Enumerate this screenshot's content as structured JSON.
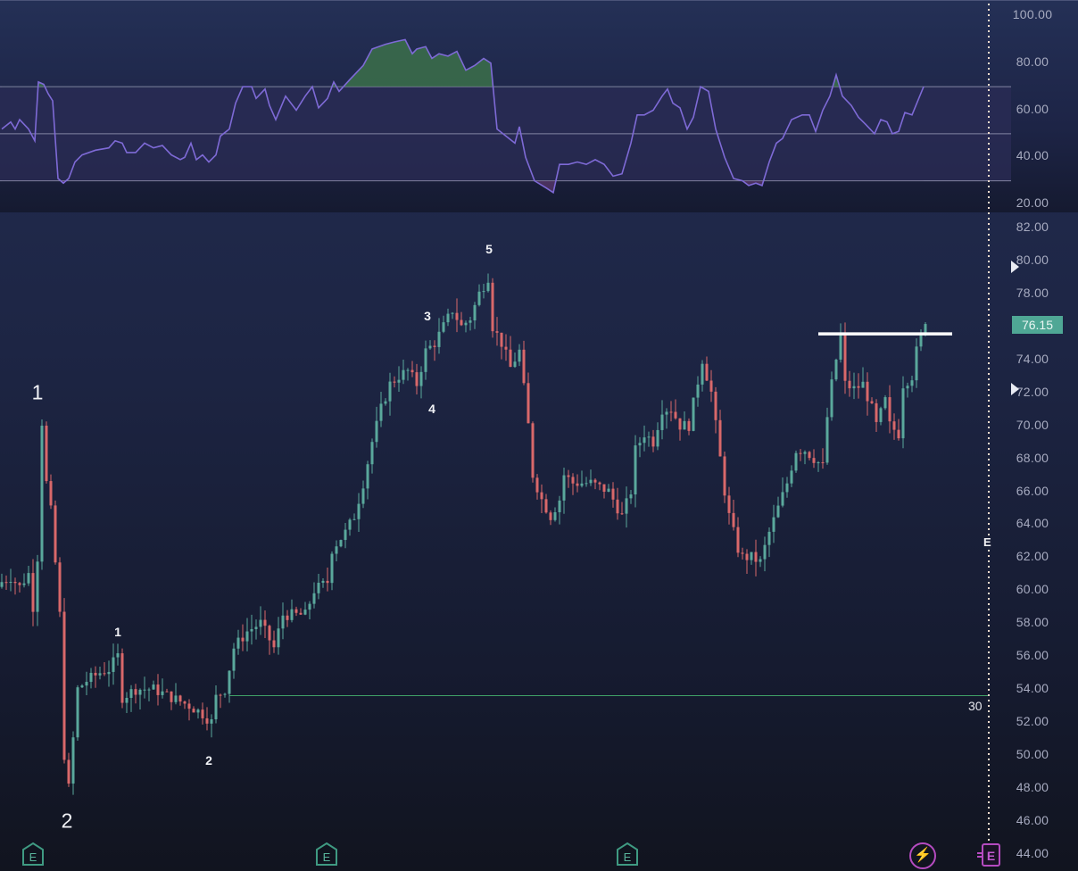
{
  "colors": {
    "up": "#5aa89c",
    "down": "#d9686a",
    "rsi_line": "#7e6ad6",
    "rsi_band": "#2b2c55",
    "level_line": "#9a9cb8",
    "support_line": "#3fa066",
    "resistance_line": "#ffffff",
    "crosshair": "#f1dccd",
    "last_price_bg": "#4fa795",
    "earnings_marker": "#3f9a82",
    "event_marker": "#b54bc0"
  },
  "rsi_axis": {
    "ticks": [
      "100.00",
      "80.00",
      "60.00",
      "40.00",
      "20.00"
    ]
  },
  "price_axis": {
    "ticks": [
      "82.00",
      "80.00",
      "78.00",
      "76.00",
      "74.00",
      "72.00",
      "70.00",
      "68.00",
      "66.00",
      "64.00",
      "62.00",
      "60.00",
      "58.00",
      "56.00",
      "54.00",
      "52.00",
      "50.00",
      "48.00",
      "46.00",
      "44.00"
    ]
  },
  "last_price": "76.15",
  "count_label": "30",
  "future_event_label": "E",
  "earnings_icon_label": "E",
  "event_icons": {
    "bolt": "⚡",
    "earnings": "E"
  },
  "wave_labels": {
    "major_1": "1",
    "major_2": "2",
    "minor_1": "1",
    "minor_2": "2",
    "minor_3": "3",
    "minor_4": "4",
    "minor_5": "5"
  },
  "chart_data": [
    {
      "type": "line",
      "title": "RSI",
      "ylim": [
        20,
        100
      ],
      "levels": [
        70,
        50,
        30
      ],
      "points": [
        [
          0,
          52
        ],
        [
          2,
          55
        ],
        [
          3,
          52
        ],
        [
          4,
          56
        ],
        [
          6,
          52
        ],
        [
          7.4,
          47
        ],
        [
          8.2,
          72
        ],
        [
          9.4,
          71
        ],
        [
          10.4,
          67
        ],
        [
          11.4,
          64
        ],
        [
          12.6,
          31
        ],
        [
          13.8,
          29
        ],
        [
          15,
          31
        ],
        [
          16.4,
          38
        ],
        [
          18,
          41
        ],
        [
          21,
          43
        ],
        [
          24,
          44
        ],
        [
          25.4,
          47
        ],
        [
          27,
          46
        ],
        [
          28,
          42
        ],
        [
          30,
          42
        ],
        [
          32,
          46
        ],
        [
          34,
          44
        ],
        [
          36,
          45
        ],
        [
          38,
          41
        ],
        [
          40,
          39
        ],
        [
          41,
          40
        ],
        [
          42.4,
          46
        ],
        [
          43.6,
          39
        ],
        [
          45,
          41
        ],
        [
          46.4,
          38
        ],
        [
          48,
          41
        ],
        [
          49,
          49
        ],
        [
          51,
          52
        ],
        [
          52.4,
          63
        ],
        [
          54,
          70
        ],
        [
          56,
          70
        ],
        [
          57,
          65
        ],
        [
          59,
          69
        ],
        [
          60,
          62
        ],
        [
          61.4,
          56
        ],
        [
          63.6,
          66
        ],
        [
          66,
          60
        ],
        [
          68,
          66
        ],
        [
          69.6,
          70
        ],
        [
          71,
          61
        ],
        [
          73,
          65
        ],
        [
          74.4,
          72
        ],
        [
          75.6,
          68
        ],
        [
          78,
          73
        ],
        [
          81,
          79
        ],
        [
          83,
          86
        ],
        [
          86,
          88
        ],
        [
          88,
          89
        ],
        [
          90.4,
          90
        ],
        [
          92,
          84
        ],
        [
          93,
          86
        ],
        [
          95,
          87
        ],
        [
          96.4,
          82
        ],
        [
          98,
          84
        ],
        [
          100,
          83
        ],
        [
          102,
          85
        ],
        [
          104,
          77
        ],
        [
          106,
          79
        ],
        [
          108,
          82
        ],
        [
          109.6,
          80
        ],
        [
          111,
          52
        ],
        [
          113,
          49
        ],
        [
          115,
          46
        ],
        [
          116,
          53
        ],
        [
          117.4,
          40
        ],
        [
          119.4,
          30
        ],
        [
          122,
          27
        ],
        [
          123.6,
          25
        ],
        [
          125,
          37
        ],
        [
          127,
          37
        ],
        [
          129,
          38
        ],
        [
          131,
          37
        ],
        [
          133,
          39
        ],
        [
          135,
          37
        ],
        [
          137,
          32
        ],
        [
          139,
          33
        ],
        [
          141,
          46
        ],
        [
          142.4,
          58
        ],
        [
          144,
          58
        ],
        [
          146,
          60
        ],
        [
          148,
          66
        ],
        [
          149.2,
          69
        ],
        [
          150.4,
          63
        ],
        [
          152,
          61
        ],
        [
          153.6,
          52
        ],
        [
          155,
          57
        ],
        [
          156.6,
          70
        ],
        [
          158.4,
          68
        ],
        [
          160,
          52
        ],
        [
          162,
          40
        ],
        [
          164,
          31
        ],
        [
          166,
          30
        ],
        [
          167.4,
          28
        ],
        [
          169,
          29
        ],
        [
          170.4,
          28
        ],
        [
          172,
          38
        ],
        [
          173.6,
          46
        ],
        [
          175,
          48
        ],
        [
          177,
          56
        ],
        [
          179.4,
          58
        ],
        [
          181,
          58
        ],
        [
          182.4,
          51
        ],
        [
          184,
          60
        ],
        [
          185.6,
          66
        ],
        [
          187,
          75
        ],
        [
          188.4,
          66
        ],
        [
          190.4,
          62
        ],
        [
          192,
          57
        ],
        [
          193.6,
          54
        ],
        [
          195.6,
          50
        ],
        [
          197,
          56
        ],
        [
          198.4,
          55
        ],
        [
          199.6,
          50
        ],
        [
          201,
          51
        ],
        [
          202.4,
          59
        ],
        [
          204,
          58
        ],
        [
          206.6,
          70
        ]
      ]
    },
    {
      "type": "candlestick",
      "title": "Price",
      "ylim": [
        44,
        82
      ],
      "bars": 208,
      "close_anchors": [
        [
          0,
          60.5
        ],
        [
          2,
          60.8
        ],
        [
          4,
          60.2
        ],
        [
          6,
          61
        ],
        [
          7,
          59
        ],
        [
          8,
          62
        ],
        [
          9,
          70.2
        ],
        [
          10,
          66.5
        ],
        [
          11,
          64.8
        ],
        [
          13,
          58.5
        ],
        [
          14,
          50
        ],
        [
          15,
          48
        ],
        [
          16,
          51
        ],
        [
          17,
          54
        ],
        [
          19,
          54.5
        ],
        [
          22,
          55
        ],
        [
          24,
          55.2
        ],
        [
          26,
          56
        ],
        [
          27,
          53.5
        ],
        [
          30,
          54
        ],
        [
          34,
          54
        ],
        [
          38,
          53.5
        ],
        [
          42,
          53
        ],
        [
          45,
          52.5
        ],
        [
          47,
          52
        ],
        [
          48,
          53.5
        ],
        [
          50,
          54
        ],
        [
          52,
          56.5
        ],
        [
          55,
          57.5
        ],
        [
          58,
          58
        ],
        [
          61,
          56.5
        ],
        [
          63,
          58.5
        ],
        [
          68,
          58.5
        ],
        [
          70,
          60
        ],
        [
          73,
          60.5
        ],
        [
          74,
          62.5
        ],
        [
          77,
          63.5
        ],
        [
          79,
          64.5
        ],
        [
          81,
          66.5
        ],
        [
          83,
          69
        ],
        [
          85,
          71
        ],
        [
          87,
          72.5
        ],
        [
          89,
          73
        ],
        [
          91,
          73.3
        ],
        [
          93,
          72.5
        ],
        [
          95,
          74.5
        ],
        [
          97,
          75
        ],
        [
          99,
          76
        ],
        [
          101,
          77
        ],
        [
          103,
          76
        ],
        [
          105,
          76.5
        ],
        [
          107,
          78
        ],
        [
          109,
          79
        ],
        [
          110,
          76
        ],
        [
          112,
          75
        ],
        [
          114,
          73.5
        ],
        [
          116,
          74.5
        ],
        [
          118,
          70
        ],
        [
          119,
          67
        ],
        [
          121,
          65.5
        ],
        [
          122,
          65
        ],
        [
          123,
          64.5
        ],
        [
          125,
          65.5
        ],
        [
          126,
          67
        ],
        [
          128,
          66.5
        ],
        [
          132,
          66.5
        ],
        [
          136,
          66
        ],
        [
          138,
          65
        ],
        [
          139,
          64.5
        ],
        [
          141,
          66
        ],
        [
          142,
          68.5
        ],
        [
          144,
          69.5
        ],
        [
          146,
          69
        ],
        [
          148,
          71
        ],
        [
          150,
          71
        ],
        [
          152,
          70
        ],
        [
          154,
          70
        ],
        [
          157,
          74
        ],
        [
          158,
          73
        ],
        [
          159,
          72
        ],
        [
          161,
          68
        ],
        [
          162,
          66
        ],
        [
          163,
          64.5
        ],
        [
          165,
          62.5
        ],
        [
          166,
          62
        ],
        [
          168,
          62
        ],
        [
          170,
          61.7
        ],
        [
          172,
          63.5
        ],
        [
          174,
          65
        ],
        [
          176,
          66.5
        ],
        [
          178,
          68.5
        ],
        [
          180,
          68.5
        ],
        [
          182,
          68
        ],
        [
          184,
          67.5
        ],
        [
          185,
          70.5
        ],
        [
          186,
          72.5
        ],
        [
          188,
          75.5
        ],
        [
          189,
          72.5
        ],
        [
          191,
          72.2
        ],
        [
          193,
          72.5
        ],
        [
          195,
          71
        ],
        [
          196,
          70
        ],
        [
          198,
          71.5
        ],
        [
          199,
          70
        ],
        [
          201,
          69.5
        ],
        [
          202,
          72.5
        ],
        [
          204,
          73
        ],
        [
          205,
          74.5
        ],
        [
          207,
          76.15
        ]
      ],
      "support_level": 53.6,
      "support_from_bar": 51,
      "resistance_level": 75.55,
      "resistance_bars": [
        183,
        213
      ],
      "alert_levels": [
        80.0,
        72.0
      ]
    }
  ]
}
